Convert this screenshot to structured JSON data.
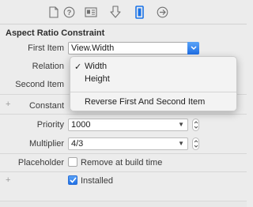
{
  "tabs": [
    {
      "icon": "file-icon"
    },
    {
      "icon": "help-icon"
    },
    {
      "icon": "identity-icon"
    },
    {
      "icon": "attributes-icon"
    },
    {
      "icon": "size-icon",
      "selected": true
    },
    {
      "icon": "connections-icon"
    }
  ],
  "section": {
    "title": "Aspect Ratio Constraint"
  },
  "fields": {
    "first_item_label": "First Item",
    "first_item_value": "View.Width",
    "relation_label": "Relation",
    "second_item_label": "Second Item",
    "constant_label": "Constant",
    "priority_label": "Priority",
    "priority_value": "1000",
    "multiplier_label": "Multiplier",
    "multiplier_value": "4/3",
    "placeholder_label": "Placeholder",
    "placeholder_option": "Remove at build time",
    "placeholder_checked": false,
    "installed_label": "Installed",
    "installed_checked": true
  },
  "dropdown": {
    "items": [
      {
        "label": "Width",
        "checked": true
      },
      {
        "label": "Height",
        "checked": false
      }
    ],
    "action": "Reverse First And Second Item"
  },
  "colors": {
    "accent": "#1f6fe5",
    "selected_tab": "#1a73e8"
  }
}
